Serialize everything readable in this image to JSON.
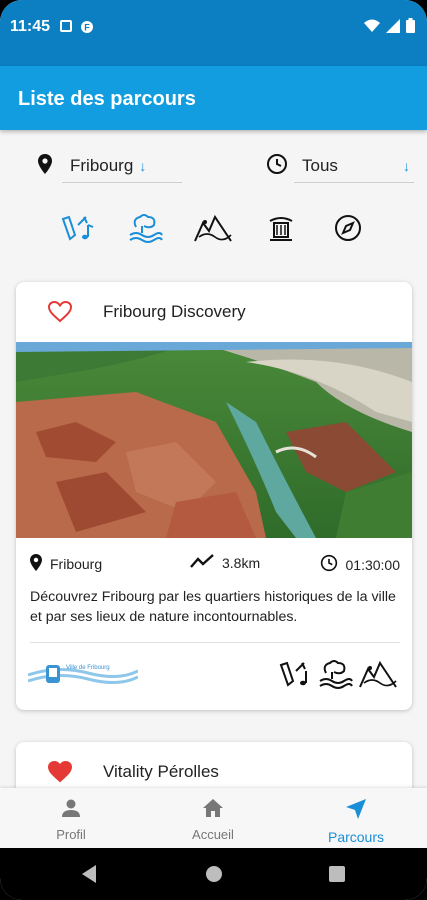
{
  "status_bar": {
    "time": "11:45"
  },
  "app_bar": {
    "title": "Liste des parcours"
  },
  "filters": {
    "city": "Fribourg",
    "duration": "Tous"
  },
  "categories": [
    {
      "icon": "music-culture-icon",
      "active": true
    },
    {
      "icon": "nature-water-icon",
      "active": true
    },
    {
      "icon": "sport-hiking-icon",
      "active": false
    },
    {
      "icon": "history-monument-icon",
      "active": false
    },
    {
      "icon": "discovery-compass-icon",
      "active": false
    }
  ],
  "routes": [
    {
      "title": "Fribourg Discovery",
      "favorite": false,
      "city": "Fribourg",
      "distance": "3.8km",
      "duration": "01:30:00",
      "description": "Découvrez Fribourg par les quartiers historiques de la ville et par ses lieux de nature incontournables.",
      "organizer": "Ville de Fribourg"
    },
    {
      "title": "Vitality Pérolles",
      "favorite": true
    }
  ],
  "bottom_nav": {
    "profile": "Profil",
    "home": "Accueil",
    "routes": "Parcours"
  },
  "colors": {
    "status_bar": "#0b7fc2",
    "app_bar": "#119de0",
    "accent": "#1a8fd8",
    "heart": "#e53935"
  }
}
